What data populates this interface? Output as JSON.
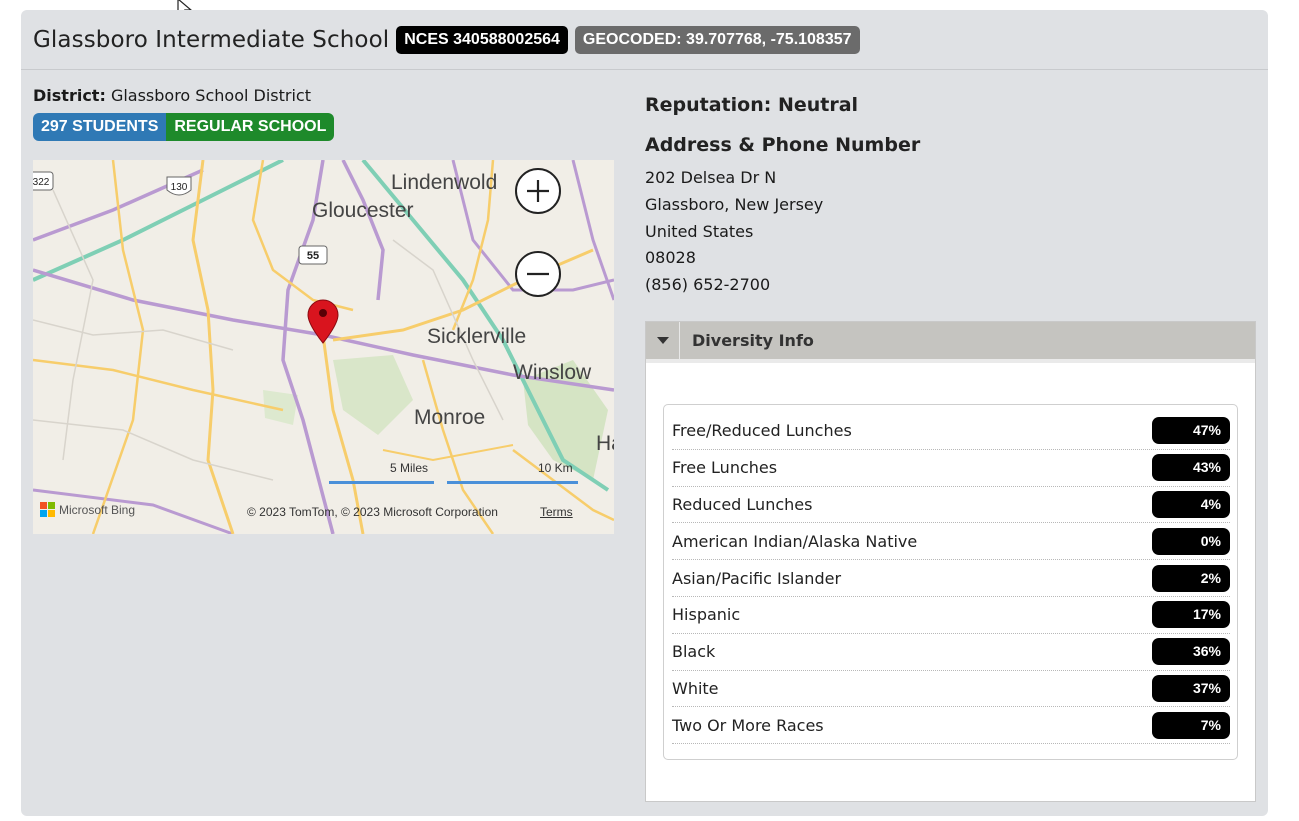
{
  "school": {
    "name": "Glassboro Intermediate School",
    "nces_badge": "NCES 340588002564",
    "geocoded_badge": "GEOCODED: 39.707768, -75.108357"
  },
  "district": {
    "label": "District:",
    "value": "Glassboro School District"
  },
  "tags": {
    "students": "297 STUDENTS",
    "type": "REGULAR SCHOOL"
  },
  "map": {
    "places": [
      "Lindenwold",
      "Gloucester",
      "Sicklerville",
      "Winslow",
      "Monroe",
      "Ha"
    ],
    "shields": [
      "322",
      "130",
      "55"
    ],
    "scale_miles": "5 Miles",
    "scale_km": "10 Km",
    "provider": "Microsoft Bing",
    "copyright": "© 2023 TomTom, © 2023 Microsoft Corporation",
    "terms": "Terms",
    "zoom_in": "+",
    "zoom_out": "−",
    "ms_colors": [
      "#f25022",
      "#7fba00",
      "#00a4ef",
      "#ffb900"
    ]
  },
  "reputation": {
    "label": "Reputation:",
    "value": "Neutral"
  },
  "address": {
    "title": "Address & Phone Number",
    "street": "202 Delsea Dr N",
    "city_state": "Glassboro, New Jersey",
    "country": "United States",
    "zip": "08028",
    "phone": "(856) 652-2700"
  },
  "diversity": {
    "title": "Diversity Info",
    "rows": [
      {
        "label": "Free/Reduced Lunches",
        "value": "47%"
      },
      {
        "label": "Free Lunches",
        "value": "43%"
      },
      {
        "label": "Reduced Lunches",
        "value": "4%"
      },
      {
        "label": "American Indian/Alaska Native",
        "value": "0%"
      },
      {
        "label": "Asian/Pacific Islander",
        "value": "2%"
      },
      {
        "label": "Hispanic",
        "value": "17%"
      },
      {
        "label": "Black",
        "value": "36%"
      },
      {
        "label": "White",
        "value": "37%"
      },
      {
        "label": "Two Or More Races",
        "value": "7%"
      }
    ]
  }
}
